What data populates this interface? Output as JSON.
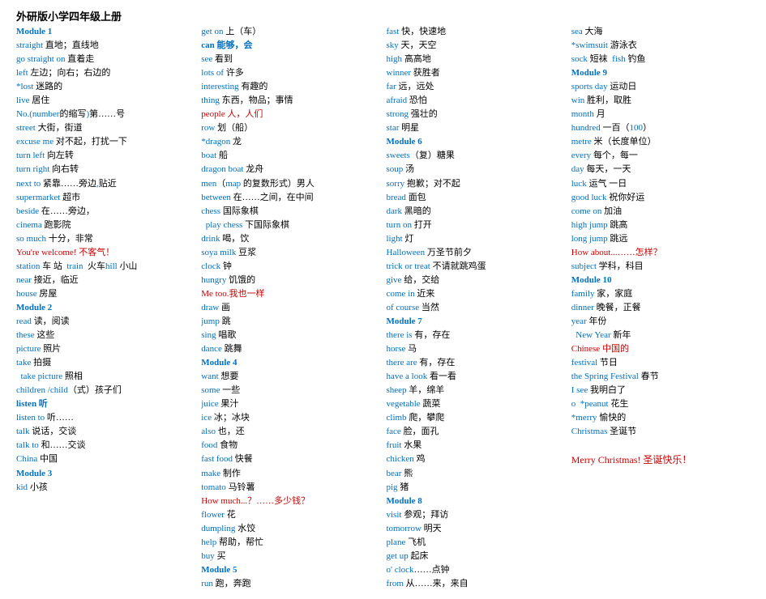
{
  "title": "外研版小学四年级上册",
  "columns": [
    {
      "id": "col1",
      "entries": [
        {
          "text": "Module 1",
          "class": "blue"
        },
        {
          "text": "straight 直地；直线地",
          "class": ""
        },
        {
          "text": "go straight on 直着走",
          "class": ""
        },
        {
          "text": "left 左边；向右；右边的",
          "class": ""
        },
        {
          "text": "*lost 迷路的",
          "class": ""
        },
        {
          "text": "live 居住",
          "class": ""
        },
        {
          "text": "No.(number的缩写)第……号",
          "class": ""
        },
        {
          "text": "street 大街，街道",
          "class": ""
        },
        {
          "text": "excuse me 对不起，打扰一下",
          "class": ""
        },
        {
          "text": "turn left 向左转",
          "class": ""
        },
        {
          "text": "turn right 向右转",
          "class": ""
        },
        {
          "text": "next to 紧靠……旁边,贴近",
          "class": ""
        },
        {
          "text": "supermarket 超市",
          "class": ""
        },
        {
          "text": "beside 在……旁边，",
          "class": ""
        },
        {
          "text": "cinema 跑影院",
          "class": ""
        },
        {
          "text": "so much 十分，非常",
          "class": ""
        },
        {
          "text": "You're welcome! 不客气！",
          "class": "red"
        },
        {
          "text": "station 车 站  train  火车hill 小山",
          "class": ""
        },
        {
          "text": "near 接近，临近",
          "class": ""
        },
        {
          "text": "house 房屋",
          "class": ""
        },
        {
          "text": "Module 2",
          "class": "blue"
        },
        {
          "text": "read 读，阅读",
          "class": ""
        },
        {
          "text": "these 这些",
          "class": ""
        },
        {
          "text": "picture 照片",
          "class": ""
        },
        {
          "text": "take 拍摄",
          "class": ""
        },
        {
          "text": "  take picture 照相",
          "class": ""
        },
        {
          "text": "children /child（式）孩子们",
          "class": ""
        },
        {
          "text": "listen 听",
          "class": "blue"
        },
        {
          "text": "listen to 听……",
          "class": ""
        },
        {
          "text": "talk 说话，交谈",
          "class": ""
        },
        {
          "text": "talk to 和……交谈",
          "class": ""
        },
        {
          "text": "China 中国",
          "class": ""
        },
        {
          "text": "Module 3",
          "class": "blue"
        },
        {
          "text": "kid 小孩",
          "class": ""
        }
      ]
    },
    {
      "id": "col2",
      "entries": [
        {
          "text": "get on 上（车）",
          "class": ""
        },
        {
          "text": "can 能够，会",
          "class": "blue"
        },
        {
          "text": "see 看到",
          "class": ""
        },
        {
          "text": "lots of 许多",
          "class": ""
        },
        {
          "text": "interesting 有趣的",
          "class": ""
        },
        {
          "text": "thing 东西，物品；事情",
          "class": ""
        },
        {
          "text": "people 人，人们",
          "class": "red"
        },
        {
          "text": "row 划（船）",
          "class": ""
        },
        {
          "text": "*dragon 龙",
          "class": ""
        },
        {
          "text": "boat 船",
          "class": ""
        },
        {
          "text": "dragon boat 龙舟",
          "class": ""
        },
        {
          "text": "men（map 的复数形式）男人",
          "class": ""
        },
        {
          "text": "between 在……之间，在中间",
          "class": ""
        },
        {
          "text": "chess 国际象棋",
          "class": ""
        },
        {
          "text": "  play chess 下国际象棋",
          "class": ""
        },
        {
          "text": "drink 喝，饮",
          "class": ""
        },
        {
          "text": "soya milk 豆浆",
          "class": ""
        },
        {
          "text": "clock 钟",
          "class": ""
        },
        {
          "text": "hungry 饥饿的",
          "class": ""
        },
        {
          "text": "Me too.我也一样",
          "class": "red"
        },
        {
          "text": "draw 画",
          "class": ""
        },
        {
          "text": "jump 跳",
          "class": ""
        },
        {
          "text": "sing 唱歌",
          "class": ""
        },
        {
          "text": "dance 跳舞",
          "class": ""
        },
        {
          "text": "Module 4",
          "class": "blue"
        },
        {
          "text": "want 想要",
          "class": ""
        },
        {
          "text": "some 一些",
          "class": ""
        },
        {
          "text": "juice 果汁",
          "class": ""
        },
        {
          "text": "ice 冰；冰块",
          "class": ""
        },
        {
          "text": "also 也，还",
          "class": ""
        },
        {
          "text": "food 食物",
          "class": ""
        },
        {
          "text": "fast food 快餐",
          "class": ""
        },
        {
          "text": "make 制作",
          "class": ""
        },
        {
          "text": "tomato 马铃薯",
          "class": ""
        },
        {
          "text": "How much...？……多少钱？",
          "class": "red"
        },
        {
          "text": "flower 花",
          "class": ""
        },
        {
          "text": "dumpling 水饺",
          "class": ""
        },
        {
          "text": "help 帮助，帮忙",
          "class": ""
        },
        {
          "text": "buy 买",
          "class": ""
        },
        {
          "text": "Module 5",
          "class": "blue"
        },
        {
          "text": "run 跑，奔跑",
          "class": ""
        }
      ]
    },
    {
      "id": "col3",
      "entries": [
        {
          "text": "fast 快，快速地",
          "class": ""
        },
        {
          "text": "sky 天，天空",
          "class": ""
        },
        {
          "text": "high 高高地",
          "class": ""
        },
        {
          "text": "winner 获胜者",
          "class": ""
        },
        {
          "text": "far 远，远处",
          "class": ""
        },
        {
          "text": "afraid 恐怕",
          "class": ""
        },
        {
          "text": "strong 强壮的",
          "class": ""
        },
        {
          "text": "star 明星",
          "class": ""
        },
        {
          "text": "Module 6",
          "class": "blue"
        },
        {
          "text": "sweets（复）糖果",
          "class": ""
        },
        {
          "text": "soup 汤",
          "class": ""
        },
        {
          "text": "sorry 抱歉；对不起",
          "class": ""
        },
        {
          "text": "bread 面包",
          "class": ""
        },
        {
          "text": "dark 黑暗的",
          "class": ""
        },
        {
          "text": "turn on 打开",
          "class": ""
        },
        {
          "text": "light 灯",
          "class": ""
        },
        {
          "text": "Halloween 万圣节前夕",
          "class": ""
        },
        {
          "text": "trick or treat 不请就跳鸡蛋",
          "class": ""
        },
        {
          "text": "give 给，交给",
          "class": ""
        },
        {
          "text": "come in 近来",
          "class": ""
        },
        {
          "text": "of course 当然",
          "class": ""
        },
        {
          "text": "Module 7",
          "class": "blue"
        },
        {
          "text": "there is 有，存在",
          "class": ""
        },
        {
          "text": "horse 马",
          "class": ""
        },
        {
          "text": "there are 有，存在",
          "class": ""
        },
        {
          "text": "have a look 看一看",
          "class": ""
        },
        {
          "text": "sheep 羊，绵羊",
          "class": ""
        },
        {
          "text": "vegetable 蔬菜",
          "class": ""
        },
        {
          "text": "climb 爬，攀爬",
          "class": ""
        },
        {
          "text": "face 脸，面孔",
          "class": ""
        },
        {
          "text": "fruit 水果",
          "class": ""
        },
        {
          "text": "chicken 鸡",
          "class": ""
        },
        {
          "text": "bear 熊",
          "class": ""
        },
        {
          "text": "pig 猪",
          "class": ""
        },
        {
          "text": "Module 8",
          "class": "blue"
        },
        {
          "text": "visit 参观；拜访",
          "class": ""
        },
        {
          "text": "tomorrow 明天",
          "class": ""
        },
        {
          "text": "plane 飞机",
          "class": ""
        },
        {
          "text": "get up 起床",
          "class": ""
        },
        {
          "text": "o' clock……点钟",
          "class": ""
        },
        {
          "text": "from 从……来，来自",
          "class": ""
        }
      ]
    },
    {
      "id": "col4",
      "entries": [
        {
          "text": "sea 大海",
          "class": ""
        },
        {
          "text": "*swimsuit 游泳衣",
          "class": ""
        },
        {
          "text": "sock 短袜  fish 钓鱼",
          "class": ""
        },
        {
          "text": "Module 9",
          "class": "blue"
        },
        {
          "text": "sports day 运动日",
          "class": ""
        },
        {
          "text": "win 胜利，取胜",
          "class": ""
        },
        {
          "text": "month 月",
          "class": ""
        },
        {
          "text": "hundred 一百（100）",
          "class": ""
        },
        {
          "text": "metre 米（长度单位）",
          "class": ""
        },
        {
          "text": "every 每个，每一",
          "class": ""
        },
        {
          "text": "day 每天，一天",
          "class": ""
        },
        {
          "text": "luck 运气 一日",
          "class": ""
        },
        {
          "text": "good luck 祝你好运",
          "class": ""
        },
        {
          "text": "come on 加油",
          "class": ""
        },
        {
          "text": "high jump 跳高",
          "class": ""
        },
        {
          "text": "long jump 跳远",
          "class": ""
        },
        {
          "text": "How about...……怎样？",
          "class": "red"
        },
        {
          "text": "subject 学科，科目",
          "class": ""
        },
        {
          "text": "Module 10",
          "class": "blue"
        },
        {
          "text": "family 家，家庭",
          "class": ""
        },
        {
          "text": "dinner 晚餐，正餐",
          "class": ""
        },
        {
          "text": "year 年份",
          "class": ""
        },
        {
          "text": "  New Year 新年",
          "class": ""
        },
        {
          "text": "Chinese 中国的",
          "class": "red"
        },
        {
          "text": "festival 节日",
          "class": ""
        },
        {
          "text": "the Spring Festival 春节",
          "class": ""
        },
        {
          "text": "I see 我明白了",
          "class": ""
        },
        {
          "text": "o  *peanut 花生",
          "class": ""
        },
        {
          "text": "*merry 愉快的",
          "class": ""
        },
        {
          "text": "Christmas 圣诞节",
          "class": ""
        },
        {
          "text": "",
          "class": ""
        },
        {
          "text": "Merry Christmas! 圣诞快乐！",
          "class": "merry"
        }
      ]
    }
  ]
}
